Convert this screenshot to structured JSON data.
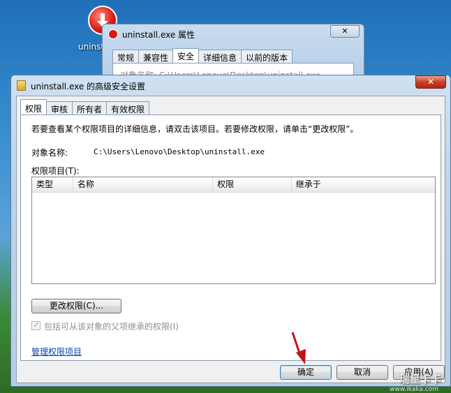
{
  "desktop": {
    "icon_label": "uninstall"
  },
  "props_window": {
    "title": "uninstall.exe 属性",
    "close_glyph": "✕",
    "tabs": [
      "常规",
      "兼容性",
      "安全",
      "详细信息",
      "以前的版本"
    ],
    "selected_tab": "安全",
    "partial_text": "对象名称:    C:\\Users\\Lenovo\\Desktop\\uninstall.exe"
  },
  "dialog": {
    "title": "uninstall.exe 的高级安全设置",
    "close_glyph": "✕",
    "tabs": [
      "权限",
      "审核",
      "所有者",
      "有效权限"
    ],
    "selected_tab": "权限",
    "info_text": "若要查看某个权限项目的详细信息，请双击该项目。若要修改权限，请单击“更改权限”。",
    "object_name_label": "对象名称:",
    "object_name_value": "C:\\Users\\Lenovo\\Desktop\\uninstall.exe",
    "permission_entries_label": "权限项目(T):",
    "columns": [
      "类型",
      "名称",
      "权限",
      "继承于"
    ],
    "change_permissions_button": "更改权限(C)...",
    "include_inheritable_label": "包括可从该对象的父项继承的权限(I)",
    "include_inheritable_checked": true,
    "manage_link": "管理权限项目",
    "ok_button": "确定",
    "cancel_button": "取消",
    "apply_button": "应用(A)"
  },
  "watermark": {
    "text": "瑞星卡卡",
    "url": "www.ikaka.com"
  },
  "colors": {
    "title_bar": "#bdd3ea",
    "close_red": "#c8402a",
    "link_blue": "#0645ad",
    "arrow_red": "#c0141a"
  }
}
